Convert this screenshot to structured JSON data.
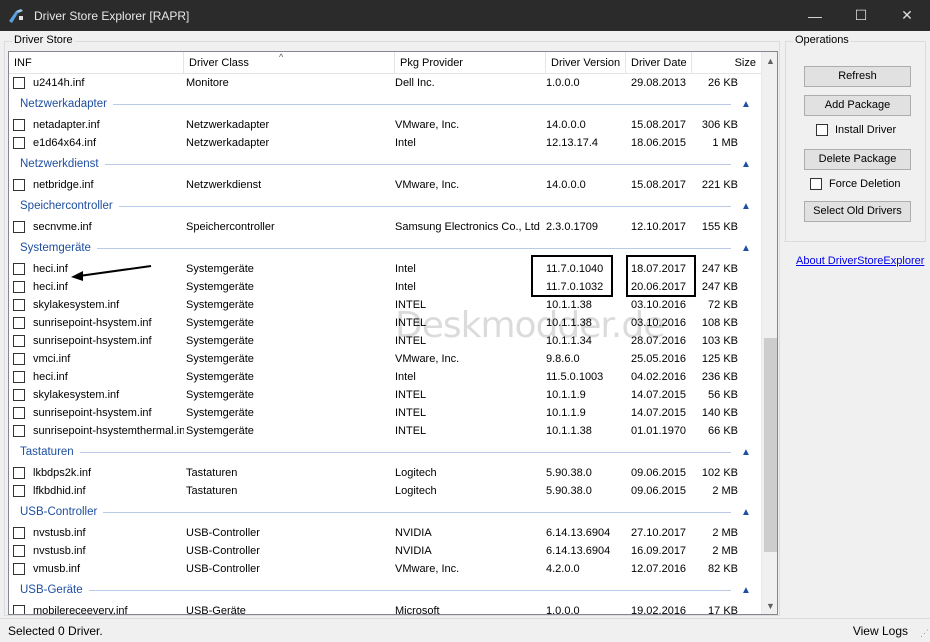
{
  "window": {
    "title": "Driver Store Explorer [RAPR]",
    "minimize": "—",
    "maximize": "☐",
    "close": "✕"
  },
  "store_group": {
    "label": "Driver Store"
  },
  "columns": [
    "INF",
    "Driver Class",
    "Pkg Provider",
    "Driver Version",
    "Driver Date",
    "Size"
  ],
  "sort_indicator": "^",
  "rows": [
    {
      "type": "item",
      "inf": "u2414h.inf",
      "cls": "Monitore",
      "prov": "Dell Inc.",
      "ver": "1.0.0.0",
      "date": "29.08.2013",
      "size": "26 KB"
    },
    {
      "type": "group",
      "name": "Netzwerkadapter"
    },
    {
      "type": "item",
      "inf": "netadapter.inf",
      "cls": "Netzwerkadapter",
      "prov": "VMware, Inc.",
      "ver": "14.0.0.0",
      "date": "15.08.2017",
      "size": "306 KB"
    },
    {
      "type": "item",
      "inf": "e1d64x64.inf",
      "cls": "Netzwerkadapter",
      "prov": "Intel",
      "ver": "12.13.17.4",
      "date": "18.06.2015",
      "size": "1 MB"
    },
    {
      "type": "group",
      "name": "Netzwerkdienst"
    },
    {
      "type": "item",
      "inf": "netbridge.inf",
      "cls": "Netzwerkdienst",
      "prov": "VMware, Inc.",
      "ver": "14.0.0.0",
      "date": "15.08.2017",
      "size": "221 KB"
    },
    {
      "type": "group",
      "name": "Speichercontroller"
    },
    {
      "type": "item",
      "inf": "secnvme.inf",
      "cls": "Speichercontroller",
      "prov": "Samsung Electronics Co., Ltd",
      "ver": "2.3.0.1709",
      "date": "12.10.2017",
      "size": "155 KB"
    },
    {
      "type": "group",
      "name": "Systemgeräte"
    },
    {
      "type": "item",
      "inf": "heci.inf",
      "cls": "Systemgeräte",
      "prov": "Intel",
      "ver": "11.7.0.1040",
      "date": "18.07.2017",
      "size": "247 KB"
    },
    {
      "type": "item",
      "inf": "heci.inf",
      "cls": "Systemgeräte",
      "prov": "Intel",
      "ver": "11.7.0.1032",
      "date": "20.06.2017",
      "size": "247 KB"
    },
    {
      "type": "item",
      "inf": "skylakesystem.inf",
      "cls": "Systemgeräte",
      "prov": "INTEL",
      "ver": "10.1.1.38",
      "date": "03.10.2016",
      "size": "72 KB"
    },
    {
      "type": "item",
      "inf": "sunrisepoint-hsystem.inf",
      "cls": "Systemgeräte",
      "prov": "INTEL",
      "ver": "10.1.1.38",
      "date": "03.10.2016",
      "size": "108 KB"
    },
    {
      "type": "item",
      "inf": "sunrisepoint-hsystem.inf",
      "cls": "Systemgeräte",
      "prov": "INTEL",
      "ver": "10.1.1.34",
      "date": "28.07.2016",
      "size": "103 KB"
    },
    {
      "type": "item",
      "inf": "vmci.inf",
      "cls": "Systemgeräte",
      "prov": "VMware, Inc.",
      "ver": "9.8.6.0",
      "date": "25.05.2016",
      "size": "125 KB"
    },
    {
      "type": "item",
      "inf": "heci.inf",
      "cls": "Systemgeräte",
      "prov": "Intel",
      "ver": "11.5.0.1003",
      "date": "04.02.2016",
      "size": "236 KB"
    },
    {
      "type": "item",
      "inf": "skylakesystem.inf",
      "cls": "Systemgeräte",
      "prov": "INTEL",
      "ver": "10.1.1.9",
      "date": "14.07.2015",
      "size": "56 KB"
    },
    {
      "type": "item",
      "inf": "sunrisepoint-hsystem.inf",
      "cls": "Systemgeräte",
      "prov": "INTEL",
      "ver": "10.1.1.9",
      "date": "14.07.2015",
      "size": "140 KB"
    },
    {
      "type": "item",
      "inf": "sunrisepoint-hsystemthermal.inf",
      "cls": "Systemgeräte",
      "prov": "INTEL",
      "ver": "10.1.1.38",
      "date": "01.01.1970",
      "size": "66 KB"
    },
    {
      "type": "group",
      "name": "Tastaturen"
    },
    {
      "type": "item",
      "inf": "lkbdps2k.inf",
      "cls": "Tastaturen",
      "prov": "Logitech",
      "ver": "5.90.38.0",
      "date": "09.06.2015",
      "size": "102 KB"
    },
    {
      "type": "item",
      "inf": "lfkbdhid.inf",
      "cls": "Tastaturen",
      "prov": "Logitech",
      "ver": "5.90.38.0",
      "date": "09.06.2015",
      "size": "2 MB"
    },
    {
      "type": "group",
      "name": "USB-Controller"
    },
    {
      "type": "item",
      "inf": "nvstusb.inf",
      "cls": "USB-Controller",
      "prov": "NVIDIA",
      "ver": "6.14.13.6904",
      "date": "27.10.2017",
      "size": "2 MB"
    },
    {
      "type": "item",
      "inf": "nvstusb.inf",
      "cls": "USB-Controller",
      "prov": "NVIDIA",
      "ver": "6.14.13.6904",
      "date": "16.09.2017",
      "size": "2 MB"
    },
    {
      "type": "item",
      "inf": "vmusb.inf",
      "cls": "USB-Controller",
      "prov": "VMware, Inc.",
      "ver": "4.2.0.0",
      "date": "12.07.2016",
      "size": "82 KB"
    },
    {
      "type": "group",
      "name": "USB-Geräte"
    },
    {
      "type": "item",
      "inf": "mobilereceeverv.inf",
      "cls": "USB-Geräte",
      "prov": "Microsoft",
      "ver": "1.0.0.0",
      "date": "19.02.2016",
      "size": "17 KB"
    }
  ],
  "watermark": "Deskmodder.de",
  "operations": {
    "label": "Operations",
    "refresh": "Refresh",
    "add_package": "Add Package",
    "install_driver": "Install Driver",
    "delete_package": "Delete Package",
    "force_deletion": "Force Deletion",
    "select_old": "Select Old Drivers"
  },
  "about_link": "About DriverStoreExplorer",
  "status": {
    "text": "Selected 0 Driver.",
    "view_logs": "View Logs"
  },
  "colors": {
    "group_header": "#1e4fa0",
    "link": "#0000ee",
    "titlebar": "#2b2b2b"
  }
}
